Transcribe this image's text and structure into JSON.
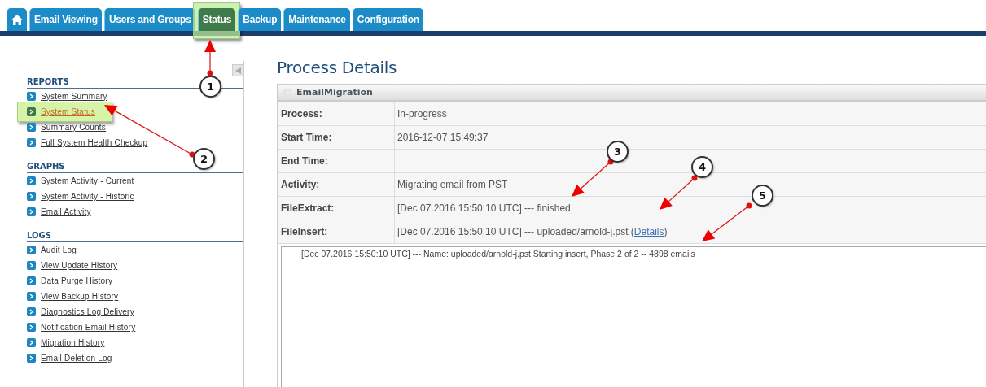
{
  "tabs": [
    {
      "kind": "home",
      "selected": false,
      "highlighted": false
    },
    {
      "kind": "text",
      "label": "Email Viewing",
      "selected": false,
      "highlighted": false
    },
    {
      "kind": "text",
      "label": "Users and Groups",
      "selected": false,
      "highlighted": false
    },
    {
      "kind": "text",
      "label": "Status",
      "selected": true,
      "highlighted": true
    },
    {
      "kind": "text",
      "label": "Backup",
      "selected": false,
      "highlighted": false
    },
    {
      "kind": "text",
      "label": "Maintenance",
      "selected": false,
      "highlighted": false
    },
    {
      "kind": "text",
      "label": "Configuration",
      "selected": false,
      "highlighted": false
    }
  ],
  "sidebar": {
    "sections": [
      {
        "heading": "REPORTS",
        "items": [
          {
            "label": "System Summary",
            "highlighted": false
          },
          {
            "label": "System Status",
            "highlighted": true
          },
          {
            "label": "Summary Counts",
            "highlighted": false
          },
          {
            "label": "Full System Health Checkup",
            "highlighted": false
          }
        ]
      },
      {
        "heading": "GRAPHS",
        "items": [
          {
            "label": "System Activity - Current",
            "highlighted": false
          },
          {
            "label": "System Activity - Historic",
            "highlighted": false
          },
          {
            "label": "Email Activity",
            "highlighted": false
          }
        ]
      },
      {
        "heading": "LOGS",
        "items": [
          {
            "label": "Audit Log",
            "highlighted": false
          },
          {
            "label": "View Update History",
            "highlighted": false
          },
          {
            "label": "Data Purge History",
            "highlighted": false
          },
          {
            "label": "View Backup History",
            "highlighted": false
          },
          {
            "label": "Diagnostics Log Delivery",
            "highlighted": false
          },
          {
            "label": "Notification Email History",
            "highlighted": false
          },
          {
            "label": "Migration History",
            "highlighted": false
          },
          {
            "label": "Email Deletion Log",
            "highlighted": false
          }
        ]
      }
    ]
  },
  "main": {
    "title": "Process Details",
    "panel": {
      "title": "EmailMigration",
      "rows": [
        {
          "label": "Process:",
          "value": "In-progress"
        },
        {
          "label": "Start Time:",
          "value": "2016-12-07 15:49:37"
        },
        {
          "label": "End Time:"
        },
        {
          "label": "Activity:",
          "value": "Migrating email from PST"
        },
        {
          "label": "FileExtract:",
          "value": "[Dec 07.2016 15:50:10 UTC] --- finished"
        },
        {
          "label": "FileInsert:",
          "value": "[Dec 07.2016 15:50:10 UTC] --- uploaded/arnold-j.pst (",
          "link": "Details",
          "value_end": ")"
        }
      ],
      "log": [
        "[Dec 07.2016 15:50:10 UTC] --- Name: uploaded/arnold-j.pst Starting insert, Phase 2 of 2 -- 4898 emails"
      ]
    }
  },
  "callouts": [
    {
      "number": "1"
    },
    {
      "number": "2"
    },
    {
      "number": "3"
    },
    {
      "number": "4"
    },
    {
      "number": "5"
    }
  ]
}
